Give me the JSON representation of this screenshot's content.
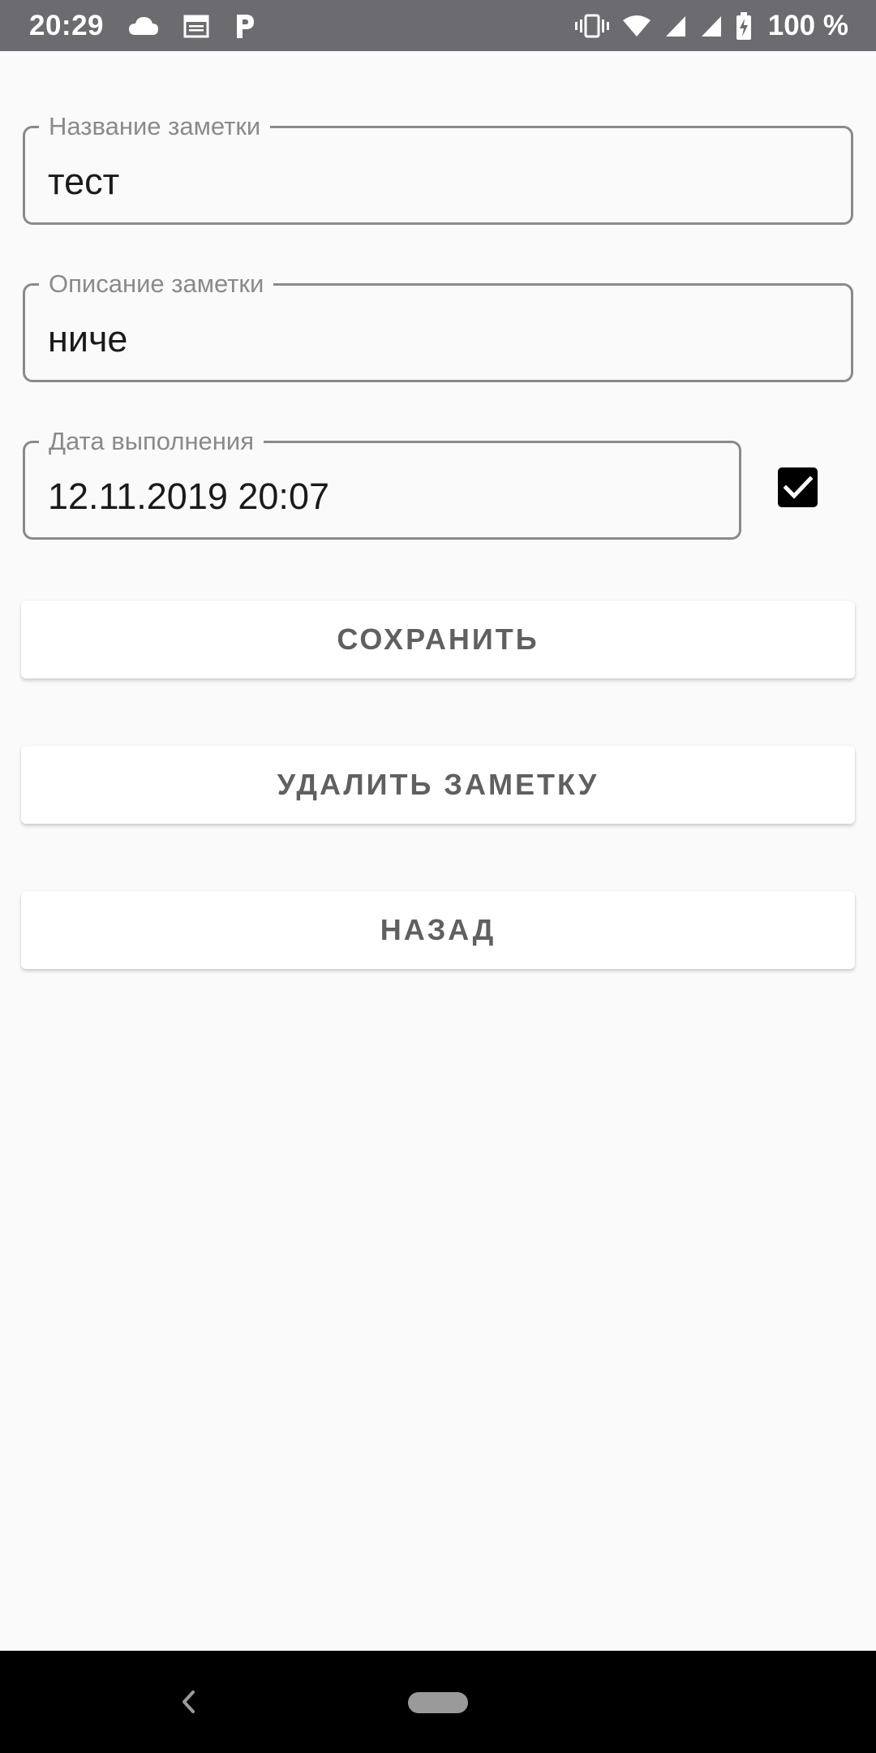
{
  "status_bar": {
    "time": "20:29",
    "left_icons": [
      "cloud-icon",
      "calendar-icon",
      "p-app-icon"
    ],
    "right_icons": [
      "vibrate-icon",
      "wifi-icon",
      "signal-icon",
      "signal-icon",
      "battery-charging-icon"
    ],
    "battery": "100 %"
  },
  "form": {
    "name_field": {
      "label": "Название заметки",
      "value": "тест"
    },
    "description_field": {
      "label": "Описание заметки",
      "value": "ниче"
    },
    "date_field": {
      "label": "Дата выполнения",
      "value": "12.11.2019 20:07"
    },
    "done_checkbox": {
      "checked": true
    }
  },
  "buttons": {
    "save": "СОХРАНИТЬ",
    "delete": "УДАЛИТЬ ЗАМЕТКУ",
    "back": "НАЗАД"
  },
  "colors": {
    "status_bar": "#6b6b70",
    "background": "#fafafa",
    "field_border": "#8a8a8a",
    "button_text": "#606060",
    "nav_bar": "#000000"
  }
}
